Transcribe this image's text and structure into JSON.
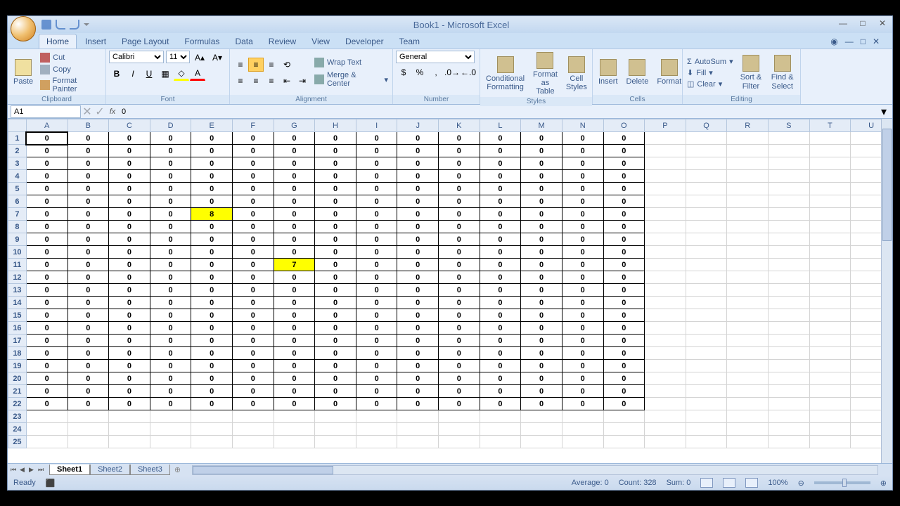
{
  "window": {
    "title": "Book1 - Microsoft Excel"
  },
  "tabs": [
    "Home",
    "Insert",
    "Page Layout",
    "Formulas",
    "Data",
    "Review",
    "View",
    "Developer",
    "Team"
  ],
  "active_tab": 0,
  "clipboard": {
    "cut": "Cut",
    "copy": "Copy",
    "fp": "Format Painter",
    "paste": "Paste",
    "label": "Clipboard"
  },
  "font": {
    "name": "Calibri",
    "size": "11",
    "label": "Font"
  },
  "alignment": {
    "wrap": "Wrap Text",
    "merge": "Merge & Center",
    "label": "Alignment"
  },
  "number": {
    "format": "General",
    "label": "Number"
  },
  "styles": {
    "cond": "Conditional Formatting",
    "fat": "Format as Table",
    "cs": "Cell Styles",
    "label": "Styles"
  },
  "cells": {
    "ins": "Insert",
    "del": "Delete",
    "fmt": "Format",
    "label": "Cells"
  },
  "editing": {
    "as": "AutoSum",
    "fill": "Fill",
    "clr": "Clear",
    "sf": "Sort & Filter",
    "fs": "Find & Select",
    "label": "Editing"
  },
  "namebox": "A1",
  "formula": "0",
  "columns": [
    "A",
    "B",
    "C",
    "D",
    "E",
    "F",
    "G",
    "H",
    "I",
    "J",
    "K",
    "L",
    "M",
    "N",
    "O",
    "P",
    "Q",
    "R",
    "S",
    "T",
    "U"
  ],
  "data_cols": 15,
  "rows": 25,
  "data_rows": 22,
  "special": {
    "E7": 8,
    "G11": 7
  },
  "highlighted": [
    "E7",
    "G11"
  ],
  "selected": "A1",
  "sheets": [
    "Sheet1",
    "Sheet2",
    "Sheet3"
  ],
  "active_sheet": 0,
  "status": {
    "ready": "Ready",
    "avg": "Average: 0",
    "count": "Count: 328",
    "sum": "Sum: 0",
    "zoom": "100%"
  },
  "chart_data": {
    "type": "table",
    "title": "Spreadsheet cell values (15 cols × 22 rows, all 0 except E7=8, G11=7)",
    "columns": [
      "A",
      "B",
      "C",
      "D",
      "E",
      "F",
      "G",
      "H",
      "I",
      "J",
      "K",
      "L",
      "M",
      "N",
      "O"
    ],
    "rows_count": 22,
    "default_value": 0,
    "overrides": {
      "E7": 8,
      "G11": 7
    }
  }
}
